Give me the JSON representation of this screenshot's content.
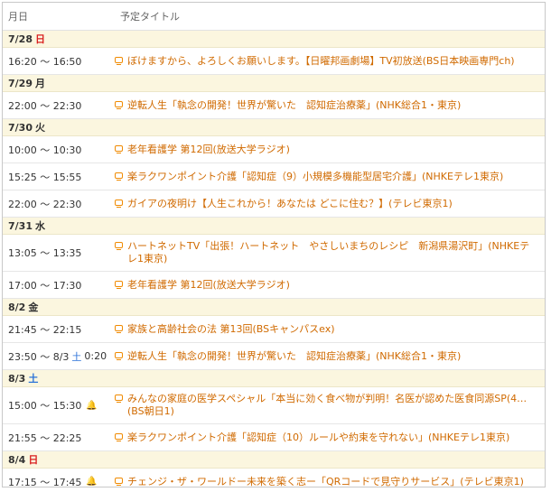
{
  "header": {
    "date_col": "月日",
    "title_col": "予定タイトル"
  },
  "days": [
    {
      "date": "7/28",
      "weekday": "日",
      "weekday_type": "sun",
      "items": [
        {
          "time": "16:20 ～ 16:50",
          "title": "ぼけますから、よろしくお願いします。【日曜邦画劇場】TV初放送(BS日本映画専門ch)"
        }
      ]
    },
    {
      "date": "7/29",
      "weekday": "月",
      "weekday_type": "wd",
      "items": [
        {
          "time": "22:00 ～ 22:30",
          "title": "逆転人生「執念の開発！世界が驚いた　認知症治療薬」(NHK総合1・東京)"
        }
      ]
    },
    {
      "date": "7/30",
      "weekday": "火",
      "weekday_type": "wd",
      "items": [
        {
          "time": "10:00 ～ 10:30",
          "title": "老年看護学 第12回(放送大学ラジオ)"
        },
        {
          "time": "15:25 ～ 15:55",
          "title": "楽ラクワンポイント介護「認知症（9）小規模多機能型居宅介護」(NHKEテレ1東京)"
        },
        {
          "time": "22:00 ～ 22:30",
          "title": "ガイアの夜明け【人生これから！あなたは どこに住む？】(テレビ東京1)"
        }
      ]
    },
    {
      "date": "7/31",
      "weekday": "水",
      "weekday_type": "wd",
      "items": [
        {
          "time": "13:05 ～ 13:35",
          "title": "ハートネットTV「出張！ハートネット　やさしいまちのレシピ　新潟県湯沢町」(NHKEテレ1東京)"
        },
        {
          "time": "17:00 ～ 17:30",
          "title": "老年看護学 第12回(放送大学ラジオ)"
        }
      ]
    },
    {
      "date": "8/2",
      "weekday": "金",
      "weekday_type": "wd",
      "items": [
        {
          "time": "21:45 ～ 22:15",
          "title": "家族と高齢社会の法 第13回(BSキャンパスex)"
        },
        {
          "time": "23:50 ～ 8/3",
          "time_day": "土",
          "time_end": "0:20",
          "title": "逆転人生「執念の開発！世界が驚いた　認知症治療薬」(NHK総合1・東京)"
        }
      ]
    },
    {
      "date": "8/3",
      "weekday": "土",
      "weekday_type": "sat",
      "items": [
        {
          "time": "15:00 ～ 15:30",
          "bell": true,
          "title": "みんなの家庭の医学スペシャル「本当に効く食べ物が判明！名医が認めた医食同源SP(4…(BS朝日1)"
        },
        {
          "time": "21:55 ～ 22:25",
          "title": "楽ラクワンポイント介護「認知症（10）ルールや約束を守れない」(NHKEテレ1東京)"
        }
      ]
    },
    {
      "date": "8/4",
      "weekday": "日",
      "weekday_type": "sun",
      "items": [
        {
          "time": "17:15 ～ 17:45",
          "bell": true,
          "title": "チェンジ・ザ・ワールドー未来を築く志ー「QRコードで見守りサービス」(テレビ東京1)"
        }
      ]
    }
  ]
}
